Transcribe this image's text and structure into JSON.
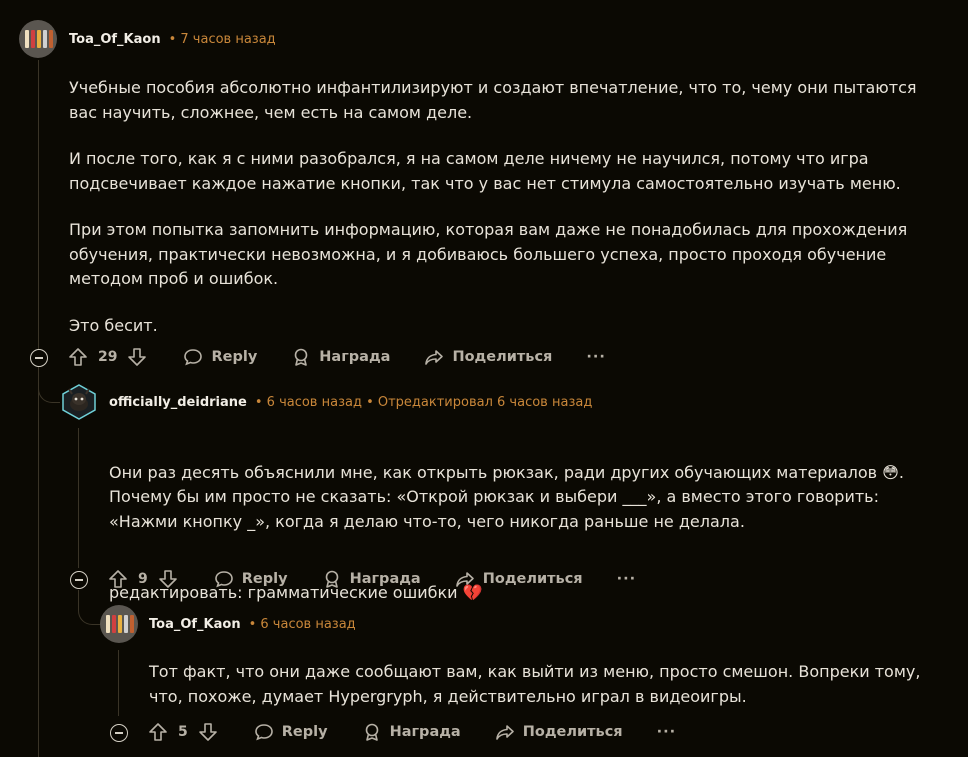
{
  "comments": [
    {
      "author": "Toa_Of_Kaon",
      "meta": "• 7 часов назад",
      "paragraphs": [
        "Учебные пособия абсолютно инфантилизируют и создают впечатление, что то, чему они пытаются вас научить, сложнее, чем есть на самом деле.",
        "И после того, как я с ними разобрался, я на самом деле ничему не научился, потому что игра подсвечивает каждое нажатие кнопки, так что у вас нет стимула самостоятельно изучать меню.",
        "При этом попытка запомнить информацию, которая вам даже не понадобилась для прохождения обучения, практически невозможна, и я добиваюсь большего успеха, просто проходя обучение методом проб и ошибок.",
        "Это бесит."
      ],
      "votes": "29"
    },
    {
      "author": "officially_deidriane",
      "meta": "• 6 часов назад • Отредактировал 6 часов назад",
      "paragraphs": [
        "Они раз десять объяснили мне, как открыть рюкзак, ради других обучающих материалов 😳.\nПочему бы им просто не сказать: «Открой рюкзак и выбери ___», а вместо этого говорить: «Нажми кнопку _», когда я делаю что-то, чего никогда раньше не делала.",
        "редактировать: грамматические ошибки 💔"
      ],
      "votes": "9"
    },
    {
      "author": "Toa_Of_Kaon",
      "meta": "• 6 часов назад",
      "paragraphs": [
        "Тот факт, что они даже сообщают вам, как выйти из меню, просто смешон. Вопреки тому, что, похоже, думает Hypergryph, я действительно играл в видеоигры."
      ],
      "votes": "5"
    }
  ],
  "actions": {
    "reply": "Reply",
    "award": "Награда",
    "share": "Поделиться",
    "more": "···"
  },
  "colors": {
    "background": "#0b0903",
    "meta": "#c9873a",
    "text": "#e8e3d9",
    "muted": "#b7b1a6"
  },
  "icons": [
    "avatar",
    "collapse-icon",
    "upvote-icon",
    "downvote-icon",
    "reply-icon",
    "award-icon",
    "share-icon",
    "more-icon"
  ]
}
